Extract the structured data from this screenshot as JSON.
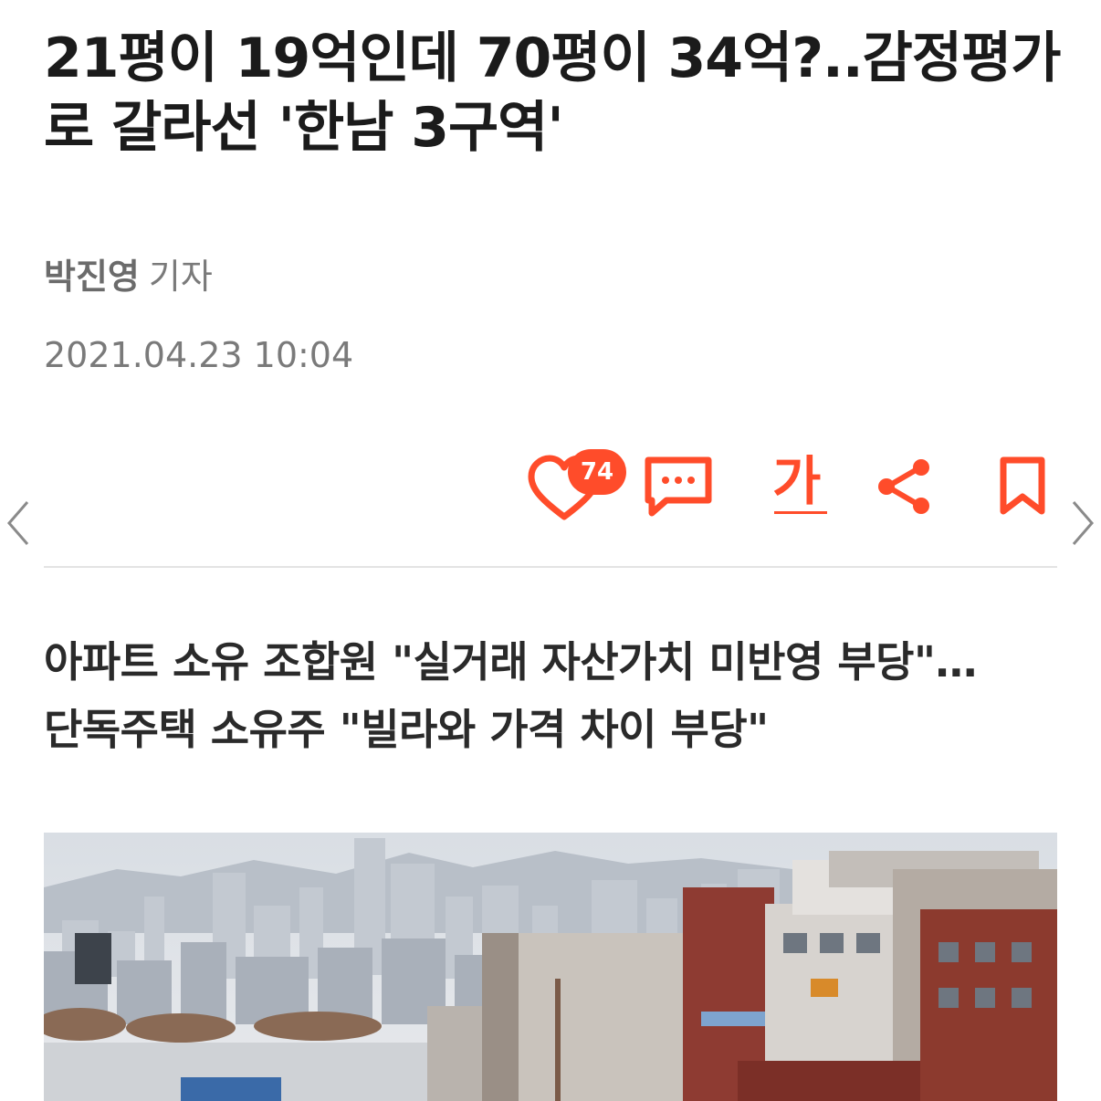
{
  "article": {
    "headline": "21평이 19억인데 70평이 34억?..감정평가로 갈라선 '한남 3구역'",
    "reporter_name": "박진영",
    "reporter_title": "기자",
    "published_at": "2021.04.23 10:04",
    "subheadline_line1": "아파트 소유 조합원 \"실거래 자산가치 미반영 부당\"…",
    "subheadline_line2": "단독주택 소유주 \"빌라와 가격 차이 부당\""
  },
  "toolbar": {
    "like_count": "74",
    "font_size_label": "가"
  },
  "icons": {
    "like": "heart-icon",
    "comment": "comment-icon",
    "font_size": "font-size-icon",
    "share": "share-icon",
    "bookmark": "bookmark-icon",
    "prev": "chevron-left-icon",
    "next": "chevron-right-icon"
  },
  "colors": {
    "accent": "#ff4c2a",
    "title": "#1b1b1b",
    "meta": "#7a7a7a",
    "divider": "#e3e3e3"
  }
}
